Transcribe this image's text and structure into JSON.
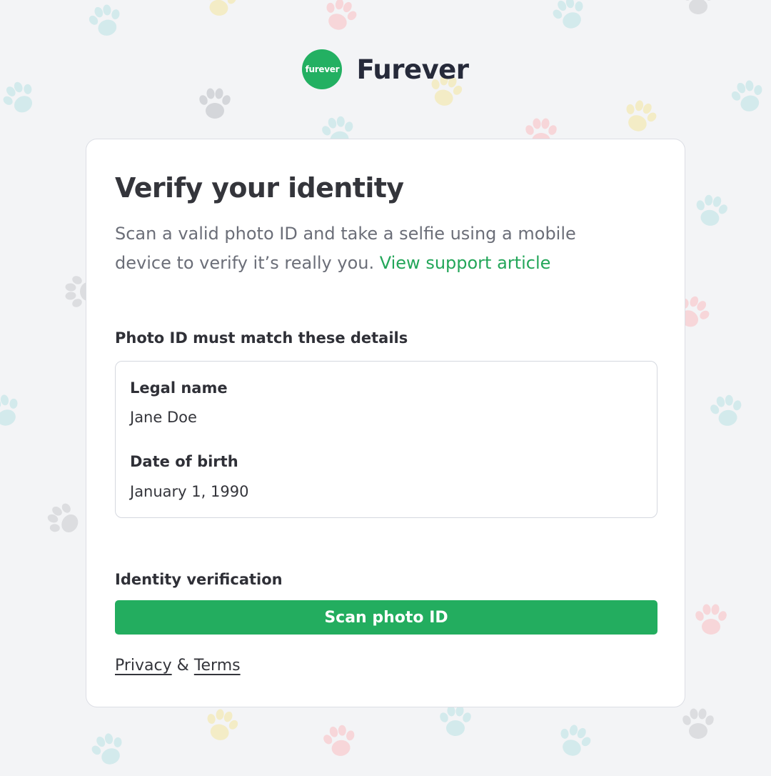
{
  "brand": {
    "logo_text": "furever",
    "name": "Furever"
  },
  "card": {
    "title": "Verify your identity",
    "description": "Scan a valid photo ID and take a selfie using a mobile device to verify it’s really you.",
    "support_link": "View support article"
  },
  "details": {
    "heading": "Photo ID must match these details",
    "legal_name_label": "Legal name",
    "legal_name_value": "Jane Doe",
    "dob_label": "Date of birth",
    "dob_value": "January 1, 1990"
  },
  "verification": {
    "heading": "Identity verification",
    "button_label": "Scan photo ID"
  },
  "footer": {
    "privacy": "Privacy",
    "separator": "&",
    "terms": "Terms"
  },
  "colors": {
    "accent": "#23ad5f",
    "background": "#f3f4f6",
    "card": "#ffffff",
    "paw_tints": [
      "#c8e6e8",
      "#f5cdd0",
      "#f2e6b8",
      "#d4d6da"
    ]
  },
  "icons": {
    "background_pattern": "paw-print-icon"
  }
}
